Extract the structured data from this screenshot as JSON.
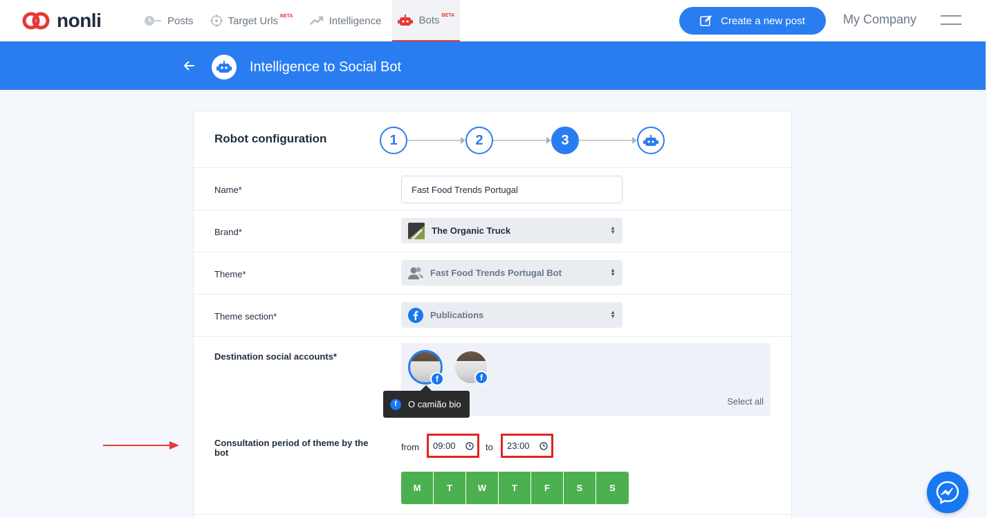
{
  "brand": {
    "name": "nonli",
    "accent": "#e53935",
    "primary": "#2a7df0"
  },
  "nav": [
    {
      "label": "Posts",
      "icon": "posts-icon",
      "beta": ""
    },
    {
      "label": "Target Urls",
      "icon": "target-icon",
      "beta": "BETA"
    },
    {
      "label": "Intelligence",
      "icon": "trend-icon",
      "beta": ""
    },
    {
      "label": "Bots",
      "icon": "robot-icon",
      "beta": "BETA"
    }
  ],
  "header": {
    "create_label": "Create a new post",
    "company": "My Company"
  },
  "page": {
    "title": "Intelligence to Social Bot"
  },
  "card": {
    "title": "Robot configuration",
    "steps": [
      "1",
      "2",
      "3"
    ],
    "active_step": "3"
  },
  "form": {
    "name_label": "Name*",
    "name_value": "Fast Food Trends Portugal",
    "brand_label": "Brand*",
    "brand_value": "The Organic Truck",
    "theme_label": "Theme*",
    "theme_value": "Fast Food Trends Portugal Bot",
    "section_label": "Theme section*",
    "section_value": "Publications",
    "dest_label": "Destination social accounts*",
    "select_all": "Select all",
    "tooltip": "O camião bio",
    "period_label": "Consultation period of theme by the bot",
    "from_word": "from",
    "to_word": "to",
    "from_time": "09:00",
    "to_time": "23:00",
    "days": [
      "M",
      "T",
      "W",
      "T",
      "F",
      "S",
      "S"
    ]
  },
  "colors": {
    "day_active": "#4caf50",
    "highlight": "#e02424"
  }
}
